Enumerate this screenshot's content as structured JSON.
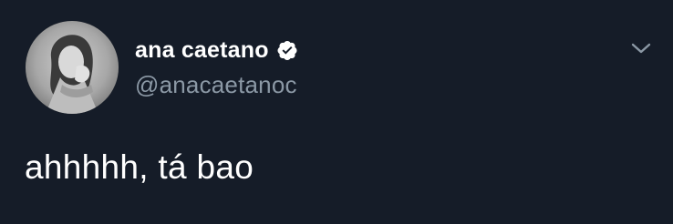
{
  "tweet": {
    "author": {
      "display_name": "ana caetano",
      "handle": "@anacaetanoc",
      "verified": true
    },
    "text": "ahhhhh, tá bao",
    "icons": {
      "avatar": "user-avatar",
      "verified": "verified-badge-icon",
      "menu": "chevron-down-icon"
    },
    "colors": {
      "background": "#151c28",
      "primary_text": "#ffffff",
      "secondary_text": "#8b98a5"
    }
  }
}
